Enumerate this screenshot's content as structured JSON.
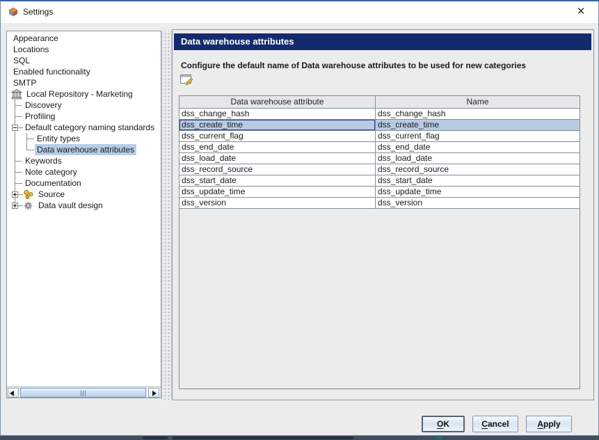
{
  "window": {
    "title": "Settings",
    "close_glyph": "×"
  },
  "icons": {
    "titlebar": "app-cube-icon",
    "close": "close-icon",
    "repository": "repository-building-icon",
    "source": "source-keys-icon",
    "data_vault": "gear-icon",
    "edit": "edit-pencil-pad-icon"
  },
  "colors": {
    "header_navy": "#142a6e",
    "selection_blue": "#b7cbe3",
    "tree_selection": "#b6cde8",
    "dialog_bg": "#ececec"
  },
  "tree": {
    "items": [
      {
        "label": "Appearance",
        "tokens": [],
        "icon": null,
        "selected": false
      },
      {
        "label": "Locations",
        "tokens": [],
        "icon": null,
        "selected": false
      },
      {
        "label": "SQL",
        "tokens": [],
        "icon": null,
        "selected": false
      },
      {
        "label": "Enabled functionality",
        "tokens": [],
        "icon": null,
        "selected": false
      },
      {
        "label": "SMTP",
        "tokens": [],
        "icon": null,
        "selected": false
      },
      {
        "label": "Local Repository - Marketing",
        "tokens": [],
        "icon": "repository",
        "selected": false
      },
      {
        "label": "Discovery",
        "tokens": [
          "tee"
        ],
        "icon": null,
        "selected": false
      },
      {
        "label": "Profiling",
        "tokens": [
          "tee"
        ],
        "icon": null,
        "selected": false
      },
      {
        "label": "Default category naming standards",
        "tokens": [
          "minus"
        ],
        "icon": null,
        "selected": false
      },
      {
        "label": "Entity types",
        "tokens": [
          "vline",
          "tee"
        ],
        "icon": null,
        "selected": false
      },
      {
        "label": "Data warehouse attributes",
        "tokens": [
          "vline",
          "elbow"
        ],
        "icon": null,
        "selected": true
      },
      {
        "label": "Keywords",
        "tokens": [
          "tee"
        ],
        "icon": null,
        "selected": false
      },
      {
        "label": "Note category",
        "tokens": [
          "tee"
        ],
        "icon": null,
        "selected": false
      },
      {
        "label": "Documentation",
        "tokens": [
          "tee"
        ],
        "icon": null,
        "selected": false
      },
      {
        "label": "Source",
        "tokens": [
          "plus"
        ],
        "icon": "source",
        "selected": false
      },
      {
        "label": "Data vault design",
        "tokens": [
          "plus-end"
        ],
        "icon": "data_vault",
        "selected": false
      }
    ]
  },
  "panel": {
    "header": "Data warehouse attributes",
    "description": "Configure the default name of Data warehouse attributes to be used for new categories"
  },
  "table": {
    "columns": [
      "Data warehouse attribute",
      "Name"
    ],
    "rows": [
      {
        "attribute": "dss_change_hash",
        "name": "dss_change_hash",
        "selected": false
      },
      {
        "attribute": "dss_create_time",
        "name": "dss_create_time",
        "selected": true
      },
      {
        "attribute": "dss_current_flag",
        "name": "dss_current_flag",
        "selected": false
      },
      {
        "attribute": "dss_end_date",
        "name": "dss_end_date",
        "selected": false
      },
      {
        "attribute": "dss_load_date",
        "name": "dss_load_date",
        "selected": false
      },
      {
        "attribute": "dss_record_source",
        "name": "dss_record_source",
        "selected": false
      },
      {
        "attribute": "dss_start_date",
        "name": "dss_start_date",
        "selected": false
      },
      {
        "attribute": "dss_update_time",
        "name": "dss_update_time",
        "selected": false
      },
      {
        "attribute": "dss_version",
        "name": "dss_version",
        "selected": false
      }
    ]
  },
  "footer": {
    "buttons": [
      {
        "label": "OK",
        "default": true
      },
      {
        "label": "Cancel",
        "default": false
      },
      {
        "label": "Apply",
        "default": false
      }
    ]
  }
}
